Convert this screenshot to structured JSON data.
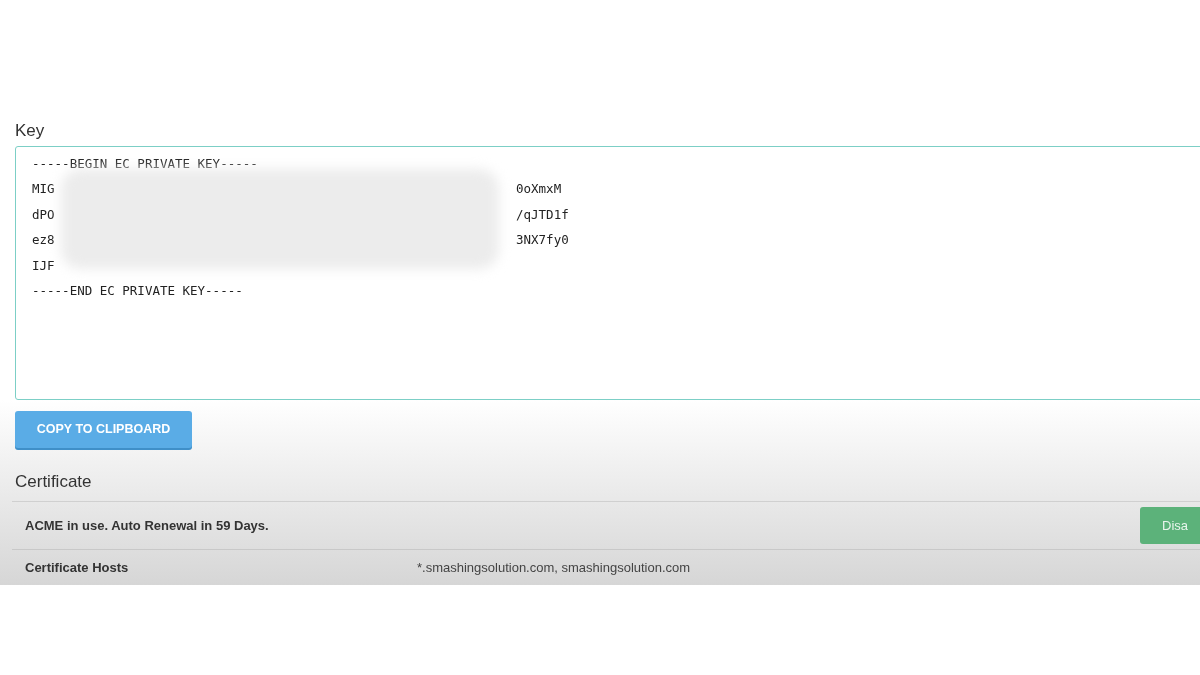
{
  "key": {
    "label": "Key",
    "header_line": "-----BEGIN EC PRIVATE KEY-----",
    "lines": [
      {
        "start": "MIG",
        "end": "0oXmxM"
      },
      {
        "start": "dPO",
        "end": "/qJTD1f"
      },
      {
        "start": "ez8",
        "end": "3NX7fy0"
      },
      {
        "start": "IJF"
      }
    ],
    "footer_line": "-----END EC PRIVATE KEY-----"
  },
  "copy_button": "COPY TO CLIPBOARD",
  "certificate": {
    "title": "Certificate",
    "rows": [
      {
        "kind": "status",
        "label": "ACME in use. Auto Renewal in 59 Days.",
        "action": "Disa"
      },
      {
        "kind": "field",
        "label": "Certificate Hosts",
        "value": "*.smashingsolution.com, smashingsolution.com"
      }
    ]
  }
}
